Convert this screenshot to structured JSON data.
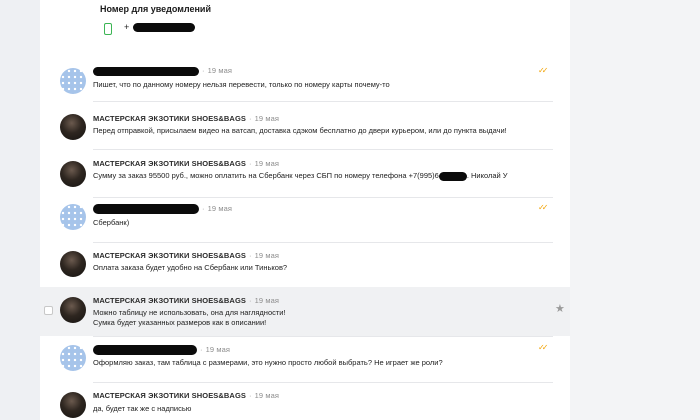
{
  "notifications": {
    "title": "Номер для уведомлений",
    "phone_prefix": "+"
  },
  "messages": [
    {
      "sender": "",
      "redacted_name": true,
      "date": "19 мая",
      "text": "Пишет, что по данному номеру нельзя перевести, только по номеру карты почему-то",
      "read": true
    },
    {
      "sender": "МАСТЕРСКАЯ ЭКЗОТИКИ SHOES&BAGS",
      "date": "19 мая",
      "text": "Перед отправкой, присылаем видео на ватсап, доставка сдэком бесплатно до двери курьером, или до пункта выдачи!"
    },
    {
      "sender": "МАСТЕРСКАЯ ЭКЗОТИКИ SHOES&BAGS",
      "date": "19 мая",
      "text_a": "Сумму за заказ 95500 руб., можно оплатить на Сбербанк через СБП по номеру телефона +7(995)6",
      "text_b": ". Николай У"
    },
    {
      "sender": "",
      "redacted_name": true,
      "date": "19 мая",
      "text": "Сбербанк)",
      "read": true
    },
    {
      "sender": "МАСТЕРСКАЯ ЭКЗОТИКИ SHOES&BAGS",
      "date": "19 мая",
      "text": "Оплата заказа будет удобно на Сбербанк или Тиньков?"
    },
    {
      "sender": "МАСТЕРСКАЯ ЭКЗОТИКИ SHOES&BAGS",
      "date": "19 мая",
      "text_line1": "Можно таблицу не использовать, она для наглядности!",
      "text_line2": "Сумка будет указанных размеров как в описании!"
    },
    {
      "sender": "",
      "redacted_name": true,
      "date": "19 мая",
      "text": "Оформляю заказ, там таблица с размерами, это нужно просто любой выбрать? Не играет же роли?",
      "read": true
    },
    {
      "sender": "МАСТЕРСКАЯ ЭКЗОТИКИ SHOES&BAGS",
      "date": "19 мая",
      "text": "да, будет так же с надписью"
    }
  ],
  "read_mark": "✓✓",
  "colors": {
    "accent": "#f2a200",
    "phone_icon": "#3cb554"
  }
}
